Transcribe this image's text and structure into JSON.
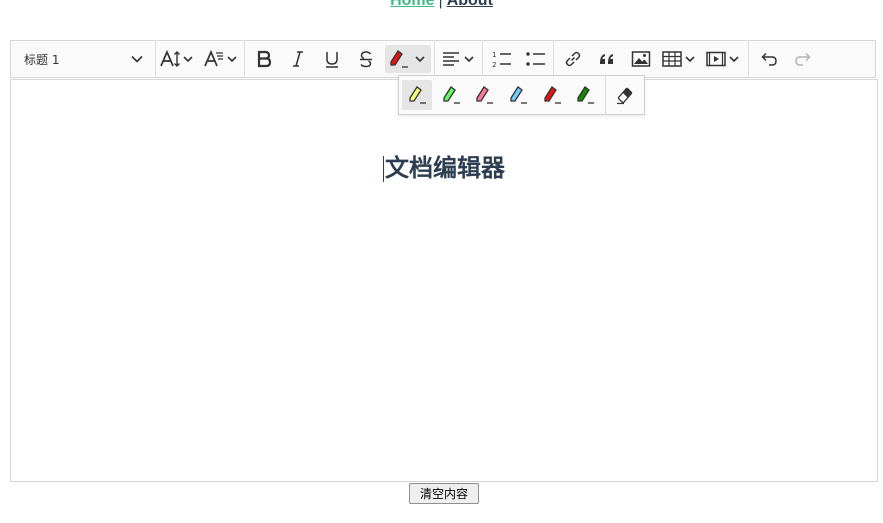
{
  "nav": {
    "home": "Home",
    "separator": "|",
    "about": "About"
  },
  "toolbar": {
    "heading_value": "标题 1",
    "icons": [
      "font-size-icon",
      "font-family-icon",
      "bold-icon",
      "italic-icon",
      "underline-icon",
      "strikethrough-icon",
      "highlight-icon",
      "align-icon",
      "numbered-list-icon",
      "bulleted-list-icon",
      "link-icon",
      "block-quote-icon",
      "insert-image-icon",
      "insert-table-icon",
      "media-embed-icon",
      "undo-icon",
      "redo-icon"
    ]
  },
  "highlight_dropdown": {
    "markers": [
      {
        "name": "yellow-marker",
        "color": "#fdfd77"
      },
      {
        "name": "green-marker",
        "color": "#62f962"
      },
      {
        "name": "pink-marker",
        "color": "#fc7899"
      },
      {
        "name": "blue-marker",
        "color": "#72ccfd"
      },
      {
        "name": "red-pen",
        "color": "#e71313"
      },
      {
        "name": "green-pen",
        "color": "#128a00"
      }
    ],
    "remove_icon": "eraser-icon"
  },
  "editor": {
    "heading": "文档编辑器"
  },
  "footer": {
    "clear_button": "清空内容"
  },
  "colors": {
    "link_green": "#42b983",
    "text_dark": "#2c3e50"
  }
}
